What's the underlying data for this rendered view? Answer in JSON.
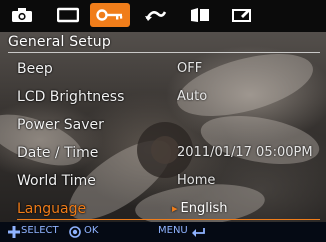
{
  "tabs": [
    {
      "icon": "camera-icon"
    },
    {
      "icon": "video-icon"
    },
    {
      "icon": "key-setup-icon",
      "active": true
    },
    {
      "icon": "return-icon"
    },
    {
      "icon": "flip-book-icon"
    },
    {
      "icon": "edit-icon"
    }
  ],
  "section_title": "General Setup",
  "settings": [
    {
      "label": "Beep",
      "value": "OFF"
    },
    {
      "label": "LCD Brightness",
      "value": "Auto"
    },
    {
      "label": "Power Saver",
      "value": ""
    },
    {
      "label": "Date / Time",
      "value": "2011/01/17  05:00PM"
    },
    {
      "label": "World Time",
      "value": "Home"
    },
    {
      "label": "Language",
      "value": "English",
      "selected": true
    }
  ],
  "footer": {
    "select_label": "SELECT",
    "ok_label": "OK",
    "menu_label": "MENU"
  },
  "colors": {
    "accent": "#f07d1a",
    "footer_text": "#8fb3ff"
  }
}
